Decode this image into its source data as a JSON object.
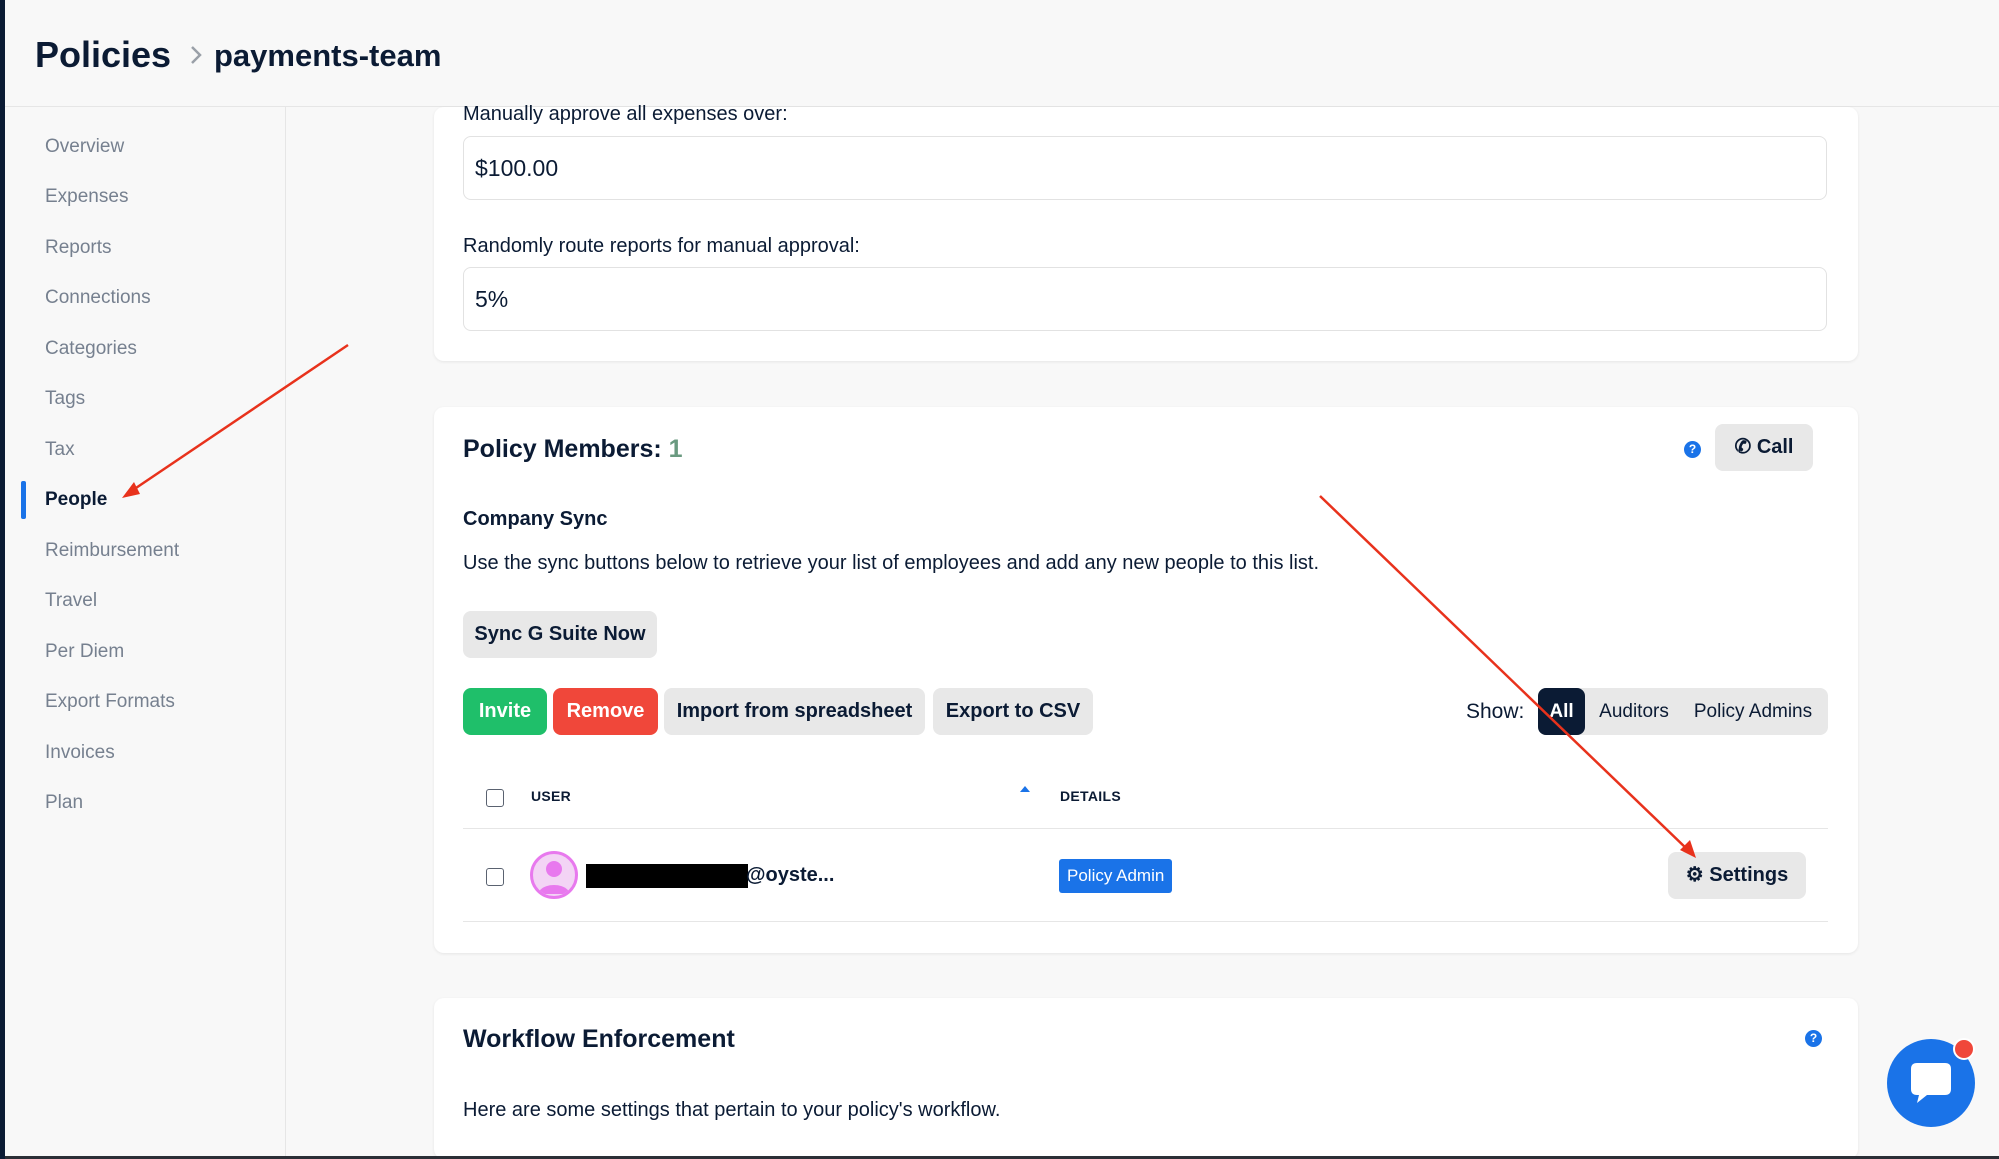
{
  "header": {
    "breadcrumb_root": "Policies",
    "breadcrumb_leaf": "payments-team"
  },
  "sidebar": {
    "items": [
      {
        "label": "Overview"
      },
      {
        "label": "Expenses"
      },
      {
        "label": "Reports"
      },
      {
        "label": "Connections"
      },
      {
        "label": "Categories"
      },
      {
        "label": "Tags"
      },
      {
        "label": "Tax"
      },
      {
        "label": "People",
        "active": true
      },
      {
        "label": "Reimbursement"
      },
      {
        "label": "Travel"
      },
      {
        "label": "Per Diem"
      },
      {
        "label": "Export Formats"
      },
      {
        "label": "Invoices"
      },
      {
        "label": "Plan"
      }
    ]
  },
  "approval": {
    "manual_label": "Manually approve all expenses over:",
    "manual_value": "$100.00",
    "random_label": "Randomly route reports for manual approval:",
    "random_value": "5%"
  },
  "members": {
    "title": "Policy Members:",
    "count": "1",
    "call_label": "Call",
    "help_glyph": "?",
    "sync_title": "Company Sync",
    "sync_desc": "Use the sync buttons below to retrieve your list of employees and add any new people to this list.",
    "sync_button": "Sync G Suite Now",
    "invite": "Invite",
    "remove": "Remove",
    "import": "Import from spreadsheet",
    "export": "Export to CSV",
    "show_label": "Show:",
    "filters": [
      {
        "label": "All",
        "active": true
      },
      {
        "label": "Auditors"
      },
      {
        "label": "Policy Admins"
      }
    ],
    "columns": {
      "user": "USER",
      "details": "DETAILS"
    },
    "rows": [
      {
        "email": "@oyste...",
        "role": "Policy Admin",
        "settings": "Settings"
      }
    ]
  },
  "workflow": {
    "title": "Workflow Enforcement",
    "desc": "Here are some settings that pertain to your policy's workflow.",
    "help_glyph": "?"
  },
  "colors": {
    "accent": "#1a73e8",
    "navy": "#0b1b34",
    "green": "#1fbf6a",
    "red": "#f0473a",
    "annotation": "#e8321c"
  }
}
